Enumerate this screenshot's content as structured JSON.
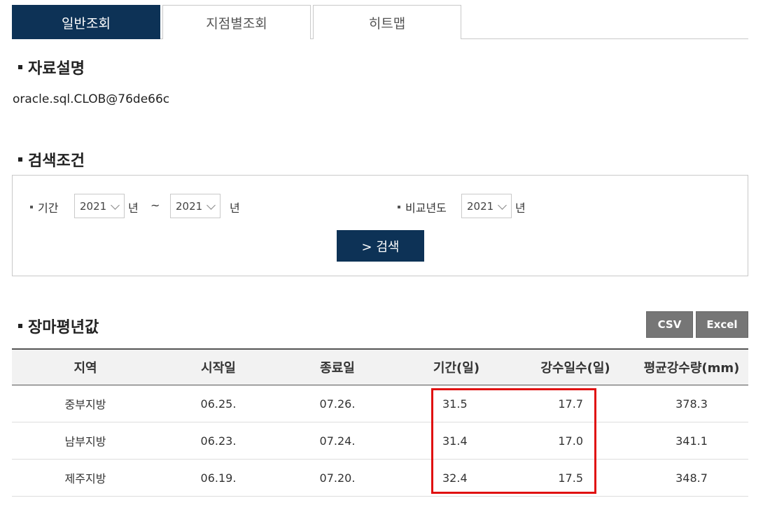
{
  "tabs": [
    {
      "label": "일반조회",
      "active": true
    },
    {
      "label": "지점별조회",
      "active": false
    },
    {
      "label": "히트맵",
      "active": false
    }
  ],
  "sections": {
    "description_title": "자료설명",
    "description_text": "oracle.sql.CLOB@76de66c",
    "search_title": "검색조건",
    "avg_title": "장마평년값"
  },
  "search": {
    "period_label": "기간",
    "start_year": "2021",
    "end_year": "2021",
    "year_unit": "년",
    "tilde": "~",
    "compare_label": "비교년도",
    "compare_year": "2021",
    "button_label": "> 검색"
  },
  "download": {
    "csv_label": "CSV",
    "excel_label": "Excel"
  },
  "table": {
    "headers": [
      "지역",
      "시작일",
      "종료일",
      "기간(일)",
      "강수일수(일)",
      "평균강수량(mm)"
    ],
    "rows": [
      [
        "중부지방",
        "06.25.",
        "07.26.",
        "31.5",
        "17.7",
        "378.3"
      ],
      [
        "남부지방",
        "06.23.",
        "07.24.",
        "31.4",
        "17.0",
        "341.1"
      ],
      [
        "제주지방",
        "06.19.",
        "07.20.",
        "32.4",
        "17.5",
        "348.7"
      ]
    ]
  },
  "colors": {
    "primary": "#0d3256",
    "highlight": "#e01010",
    "button_gray": "#767676"
  }
}
